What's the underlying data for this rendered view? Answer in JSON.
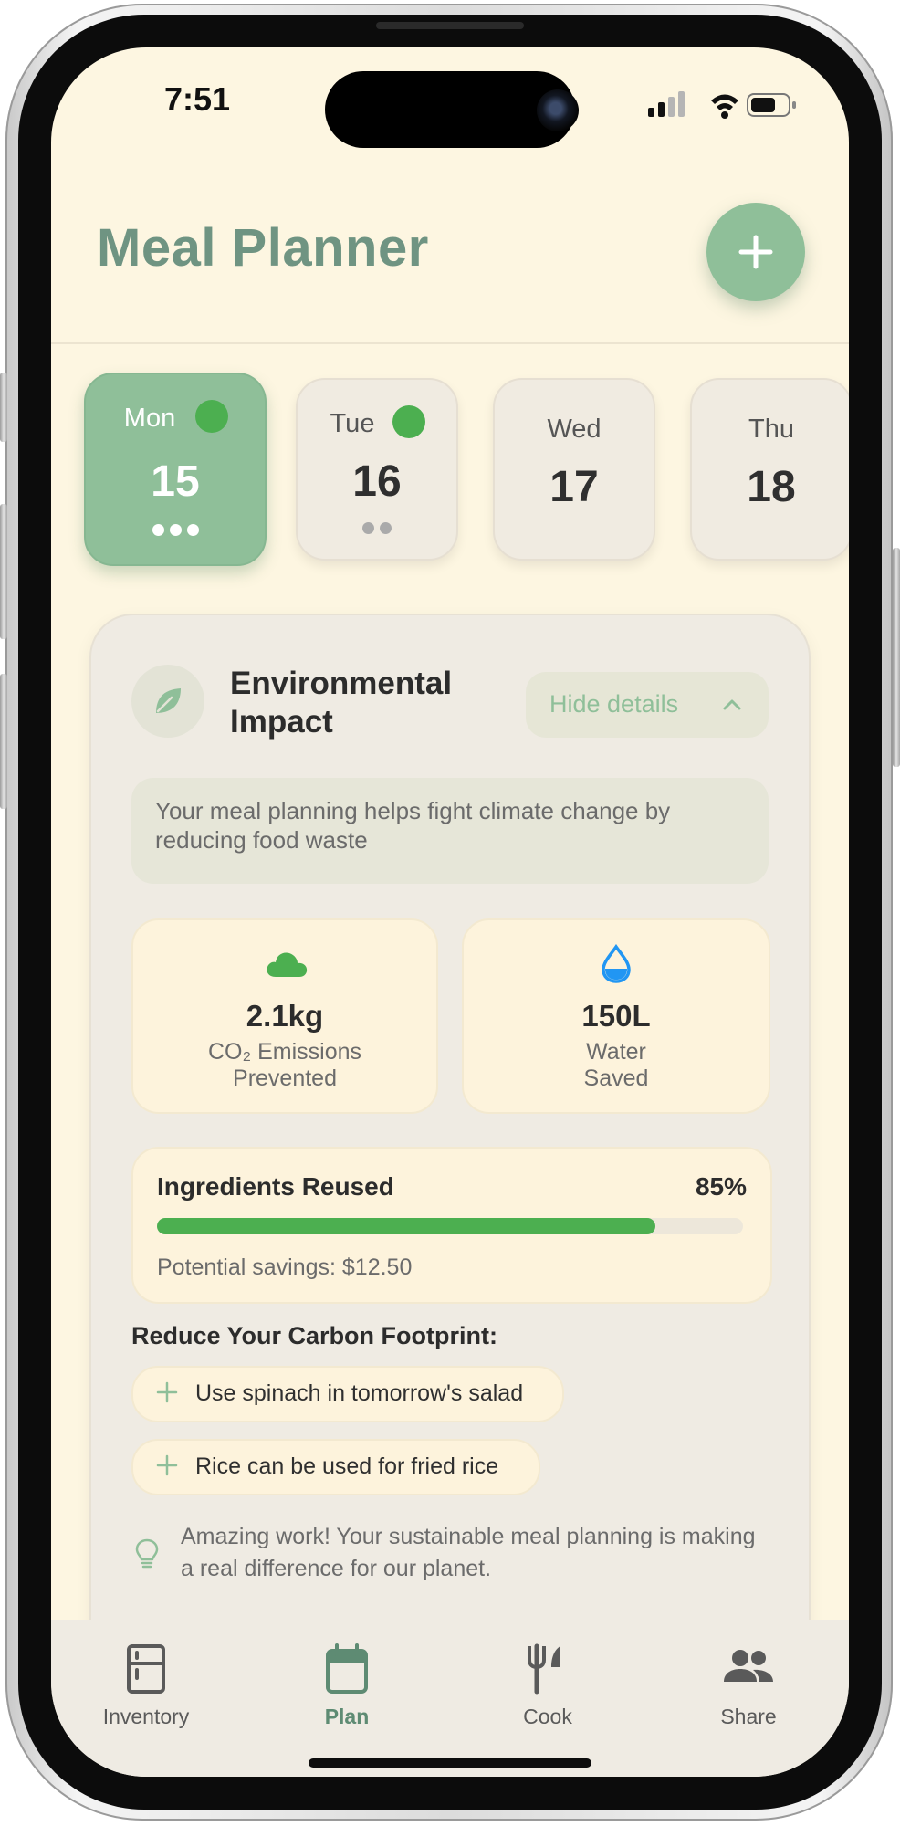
{
  "status_bar": {
    "time": "7:51"
  },
  "header": {
    "title": "Meal Planner",
    "add_icon": "plus-icon"
  },
  "days": [
    {
      "name": "Mon",
      "number": "15",
      "selected": true,
      "has_indicator": true,
      "meal_dots": 3
    },
    {
      "name": "Tue",
      "number": "16",
      "selected": false,
      "has_indicator": true,
      "meal_dots": 2
    },
    {
      "name": "Wed",
      "number": "17",
      "selected": false,
      "has_indicator": false,
      "meal_dots": 0
    },
    {
      "name": "Thu",
      "number": "18",
      "selected": false,
      "has_indicator": false,
      "meal_dots": 0
    }
  ],
  "impact": {
    "title": "Environmental Impact",
    "toggle_label": "Hide details",
    "message": "Your meal planning helps fight climate change by reducing food waste",
    "metrics": [
      {
        "icon": "cloud-icon",
        "value": "2.1kg",
        "label_line1": "CO₂ Emissions",
        "label_line2": "Prevented",
        "color": "#4caf50"
      },
      {
        "icon": "water-drop-icon",
        "value": "150L",
        "label_line1": "Water",
        "label_line2": "Saved",
        "color": "#2196f3"
      }
    ],
    "reuse": {
      "label": "Ingredients Reused",
      "percent_text": "85%",
      "progress": 0.85,
      "savings": "Potential savings: $12.50"
    },
    "tips_title": "Reduce Your Carbon Footprint:",
    "tips": [
      "Use spinach in tomorrow's salad",
      "Rice can be used for fried rice"
    ],
    "note": "Amazing work! Your sustainable meal planning is making a real difference for our planet."
  },
  "nav": [
    {
      "label": "Inventory",
      "icon": "fridge-icon",
      "active": false
    },
    {
      "label": "Plan",
      "icon": "calendar-icon",
      "active": true
    },
    {
      "label": "Cook",
      "icon": "utensils-icon",
      "active": false
    },
    {
      "label": "Share",
      "icon": "people-icon",
      "active": false
    }
  ],
  "colors": {
    "accent": "#8fbf99",
    "progress": "#4caf50",
    "title": "#6f9482",
    "background": "#fdf6e1"
  }
}
